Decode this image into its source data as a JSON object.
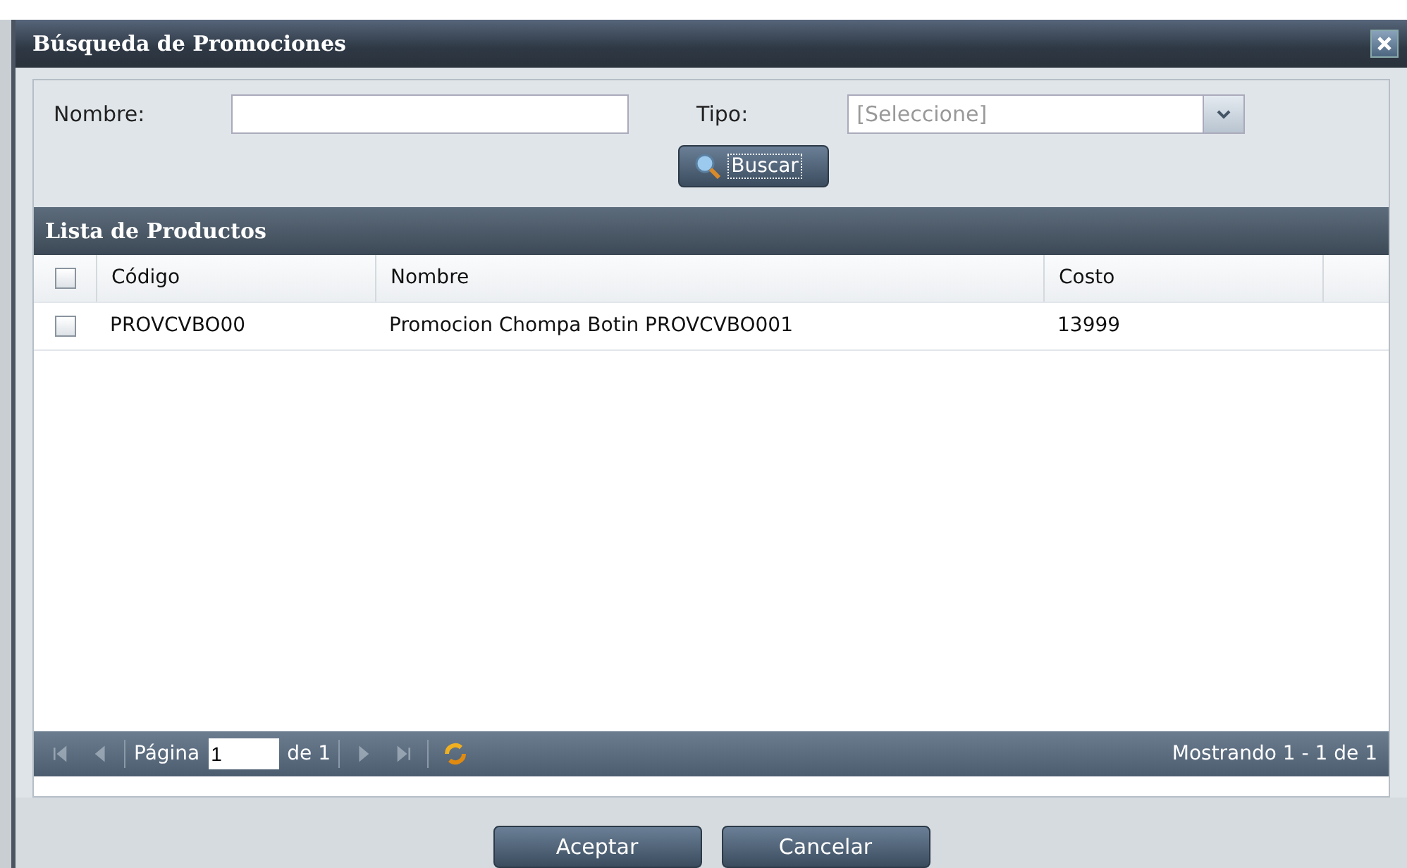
{
  "window": {
    "title": "Búsqueda de Promociones"
  },
  "form": {
    "nombre_label": "Nombre:",
    "tipo_label": "Tipo:",
    "tipo_placeholder": "[Seleccione]",
    "search_button": "Buscar"
  },
  "grid": {
    "title": "Lista de Productos",
    "header_checked": false,
    "columns": [
      "Código",
      "Nombre",
      "Costo"
    ],
    "rows": [
      {
        "checked": false,
        "cells": [
          "PROVCVBO00",
          "Promocion Chompa Botin PROVCVBO001",
          "13999"
        ]
      }
    ]
  },
  "paging": {
    "nav": [
      {
        "kind": "first",
        "disabled": true
      },
      {
        "kind": "prev",
        "disabled": true
      }
    ],
    "page_label": "Página",
    "page_value": "1",
    "of_label": "de 1",
    "nav2": [
      {
        "kind": "next",
        "disabled": true
      },
      {
        "kind": "last",
        "disabled": true
      }
    ],
    "status": "Mostrando 1 - 1 de 1"
  },
  "buttons": [
    "Aceptar",
    "Cancelar"
  ]
}
